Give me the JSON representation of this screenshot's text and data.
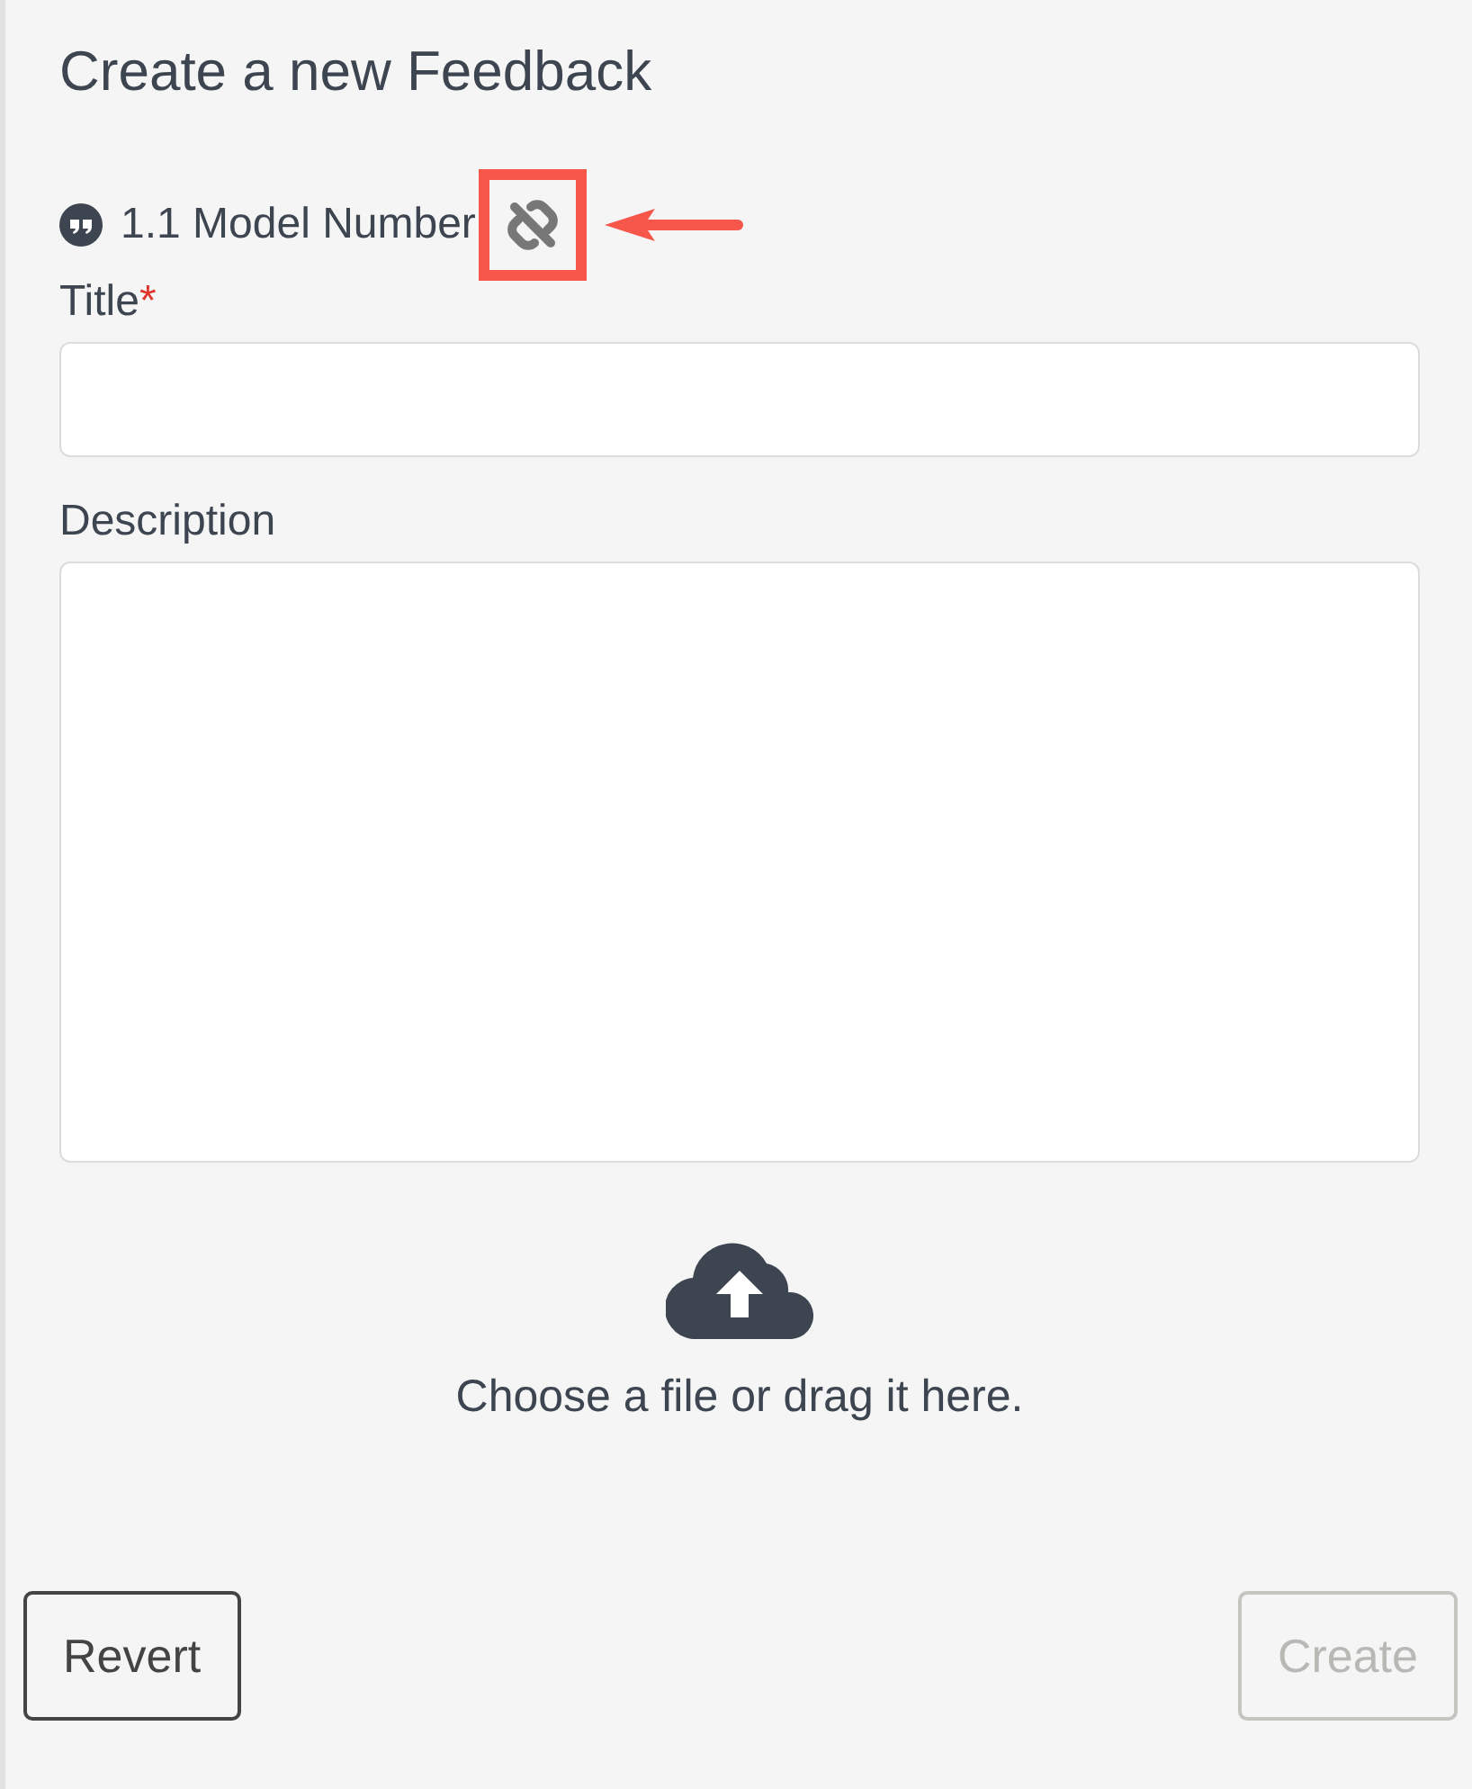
{
  "heading": "Create a new Feedback",
  "reference": {
    "label": "1.1 Model Number",
    "linked": false
  },
  "fields": [
    {
      "label": "Title",
      "required_mark": "*",
      "kind": "input"
    },
    {
      "label": "Description",
      "kind": "textarea"
    }
  ],
  "upload": {
    "text": "Choose a file or drag it here."
  },
  "buttons": [
    {
      "label": "Revert",
      "disabled": false
    },
    {
      "label": "Create",
      "disabled": true
    }
  ]
}
